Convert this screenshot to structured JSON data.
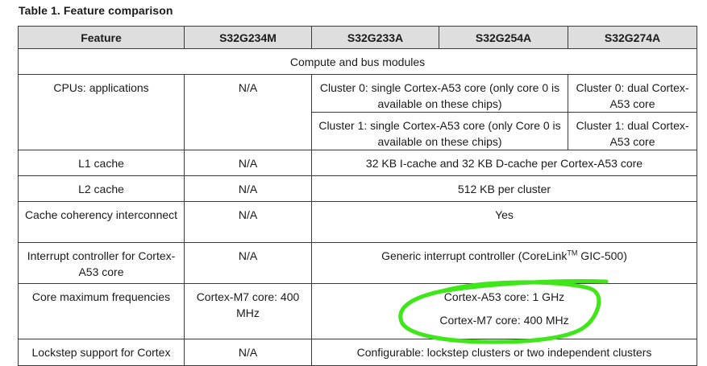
{
  "caption": "Table 1.  Feature comparison",
  "headers": [
    "Feature",
    "S32G234M",
    "S32G233A",
    "S32G254A",
    "S32G274A"
  ],
  "section": "Compute and bus modules",
  "rows": {
    "cpus": {
      "feature": "CPUs: applications",
      "s32g234m": "N/A",
      "cluster0_shared": "Cluster 0: single Cortex-A53 core (only core 0 is available on these chips)",
      "cluster0_274a": "Cluster 0: dual Cortex-A53 core",
      "cluster1_shared": "Cluster 1: single Cortex-A53 core (only Core 0 is available on these chips)",
      "cluster1_274a": "Cluster 1: dual Cortex-A53 core"
    },
    "l1": {
      "feature": "L1 cache",
      "s32g234m": "N/A",
      "others": "32 KB I-cache and 32 KB D-cache per Cortex-A53 core"
    },
    "l2": {
      "feature": "L2 cache",
      "s32g234m": "N/A",
      "others": "512 KB per cluster"
    },
    "coherency": {
      "feature": "Cache coherency interconnect",
      "s32g234m": "N/A",
      "others": "Yes"
    },
    "interrupt": {
      "feature": "Interrupt controller for Cortex-A53 core",
      "s32g234m": "N/A",
      "others_pre": "Generic interrupt controller (CoreLink",
      "others_tm": "TM",
      "others_post": " GIC-500)"
    },
    "freq": {
      "feature": "Core maximum frequencies",
      "s32g234m": "Cortex-M7 core: 400 MHz",
      "others_line1": "Cortex-A53 core: 1 GHz",
      "others_line2": "Cortex-M7 core: 400 MHz"
    },
    "lockstep": {
      "feature": "Lockstep support for Cortex",
      "s32g234m": "N/A",
      "others": "Configurable: lockstep clusters or two independent clusters"
    }
  },
  "annotation": {
    "color": "#3ee61a"
  }
}
